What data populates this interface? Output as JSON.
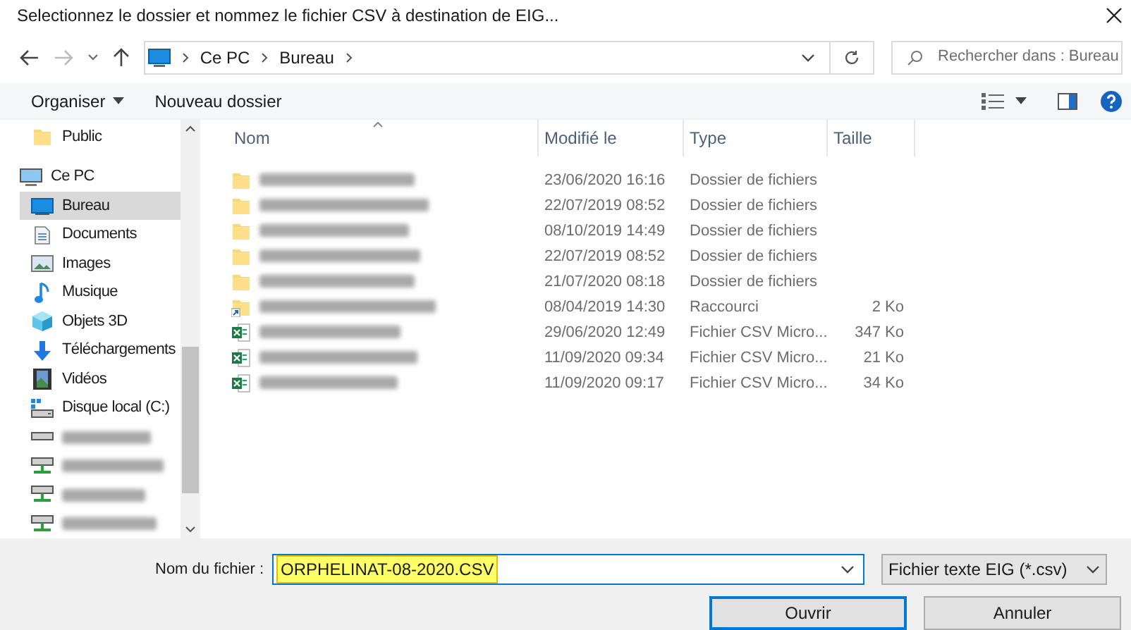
{
  "window": {
    "title": "Selectionnez le dossier et nommez le fichier CSV à destination de EIG..."
  },
  "address_bar": {
    "path": [
      "Ce PC",
      "Bureau"
    ]
  },
  "search": {
    "placeholder": "Rechercher dans : Bureau"
  },
  "toolbar": {
    "organize": "Organiser",
    "new_folder": "Nouveau dossier"
  },
  "sidebar": {
    "items": [
      {
        "kind": "folder",
        "label": "Public",
        "selected": false
      },
      {
        "kind": "pc",
        "label": "Ce PC",
        "selected": false,
        "children": [
          {
            "kind": "desktop",
            "label": "Bureau",
            "selected": true
          },
          {
            "kind": "documents",
            "label": "Documents",
            "selected": false
          },
          {
            "kind": "images",
            "label": "Images",
            "selected": false
          },
          {
            "kind": "music",
            "label": "Musique",
            "selected": false
          },
          {
            "kind": "objects3d",
            "label": "Objets 3D",
            "selected": false
          },
          {
            "kind": "download",
            "label": "Téléchargements",
            "selected": false
          },
          {
            "kind": "video",
            "label": "Vidéos",
            "selected": false
          },
          {
            "kind": "disk",
            "label": "Disque local (C:)",
            "selected": false
          },
          {
            "kind": "drive",
            "redacted": true,
            "selected": false
          },
          {
            "kind": "netdrive",
            "redacted": true,
            "selected": false
          },
          {
            "kind": "netdrive",
            "redacted": true,
            "selected": false
          },
          {
            "kind": "netdrive",
            "redacted": true,
            "selected": false
          }
        ]
      }
    ]
  },
  "table": {
    "columns": [
      "Nom",
      "Modifié le",
      "Type",
      "Taille"
    ],
    "rows": [
      {
        "kind": "folder",
        "redacted": true,
        "modified": "23/06/2020 16:16",
        "type": "Dossier de fichiers"
      },
      {
        "kind": "folder",
        "redacted": true,
        "modified": "22/07/2019 08:52",
        "type": "Dossier de fichiers"
      },
      {
        "kind": "folder",
        "redacted": true,
        "modified": "08/10/2019 14:49",
        "type": "Dossier de fichiers"
      },
      {
        "kind": "folder",
        "redacted": true,
        "modified": "22/07/2019 08:52",
        "type": "Dossier de fichiers"
      },
      {
        "kind": "folder",
        "redacted": true,
        "modified": "21/07/2020 08:18",
        "type": "Dossier de fichiers"
      },
      {
        "kind": "shortcut",
        "redacted": true,
        "modified": "08/04/2019 14:30",
        "type": "Raccourci",
        "size": "2 Ko"
      },
      {
        "kind": "csv",
        "redacted": true,
        "modified": "29/06/2020 12:49",
        "type": "Fichier CSV Micro...",
        "size": "347 Ko"
      },
      {
        "kind": "csv",
        "redacted": true,
        "modified": "11/09/2020 09:34",
        "type": "Fichier CSV Micro...",
        "size": "21 Ko"
      },
      {
        "kind": "csv",
        "redacted": true,
        "modified": "11/09/2020 09:17",
        "type": "Fichier CSV Micro...",
        "size": "34 Ko"
      }
    ]
  },
  "filename": {
    "label": "Nom du fichier :",
    "value": "ORPHELINAT-08-2020.CSV"
  },
  "filter": {
    "value": "Fichier texte EIG (*.csv)"
  },
  "buttons": [
    {
      "label": "Ouvrir",
      "default": true
    },
    {
      "label": "Annuler",
      "default": false
    }
  ]
}
